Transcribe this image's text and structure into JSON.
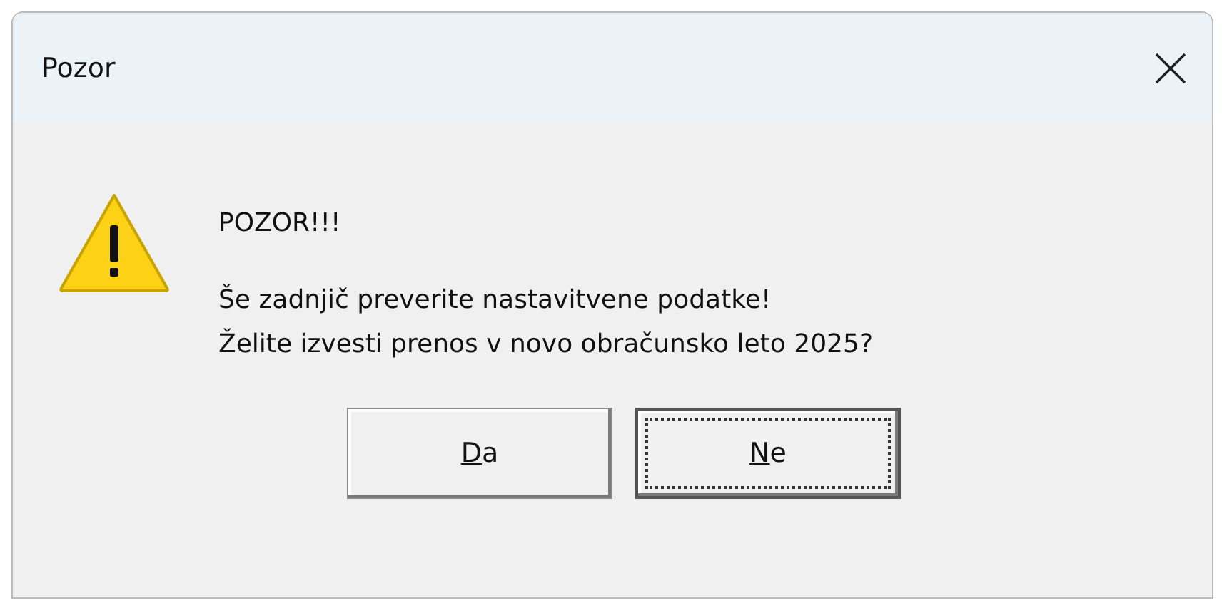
{
  "window": {
    "title": "Pozor"
  },
  "message": {
    "heading": "POZOR!!!",
    "lines": [
      "Še zadnjič preverite nastavitvene podatke!",
      "Želite izvesti prenos v novo obračunsko leto 2025?"
    ]
  },
  "buttons": [
    {
      "key": "D",
      "rest": "a",
      "focused": false
    },
    {
      "key": "N",
      "rest": "e",
      "focused": true
    }
  ]
}
